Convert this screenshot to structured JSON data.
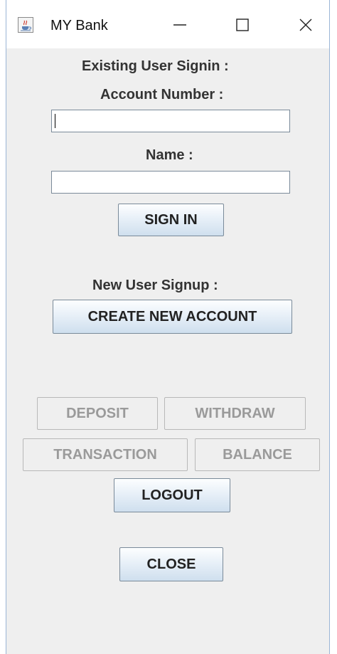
{
  "window": {
    "title": "MY Bank",
    "icon": "java-cup-icon",
    "controls": {
      "minimize_icon": "minimize-icon",
      "maximize_icon": "maximize-icon",
      "close_icon": "close-icon"
    }
  },
  "signin": {
    "heading": "Existing User Signin  :",
    "account_label": "Account Number :",
    "account_value": "",
    "name_label": "Name :",
    "name_value": "",
    "signin_button": "SIGN IN"
  },
  "signup": {
    "heading": "New User Signup  :",
    "create_button": "CREATE NEW ACCOUNT"
  },
  "actions": {
    "deposit": "DEPOSIT",
    "withdraw": "WITHDRAW",
    "transaction": "TRANSACTION",
    "balance": "BALANCE",
    "logout": "LOGOUT",
    "close": "CLOSE"
  },
  "colors": {
    "panel_background": "#efefef",
    "button_gradient_bottom": "#cfdfee",
    "disabled_text": "#9a9a9a"
  }
}
